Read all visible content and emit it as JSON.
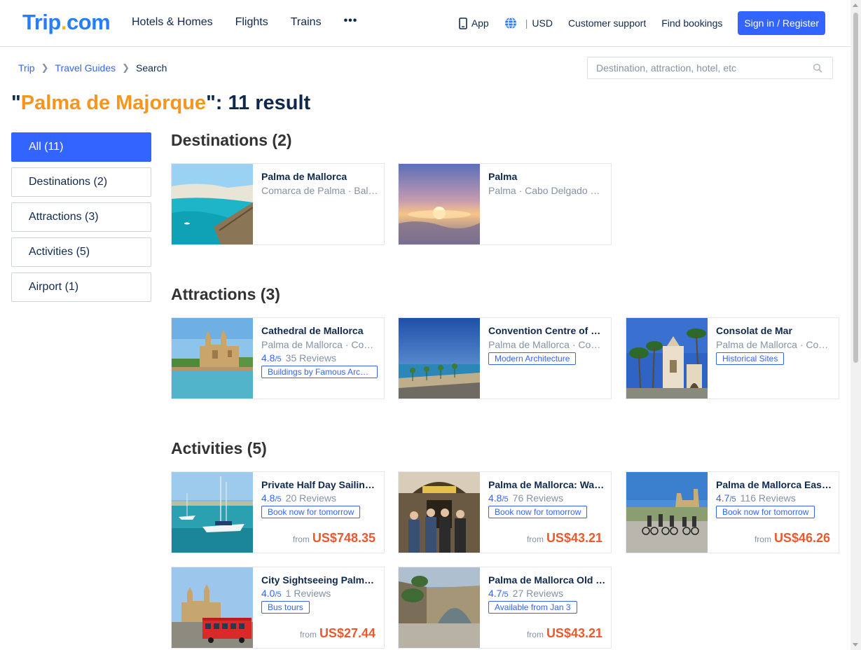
{
  "header": {
    "logo_main": "Trip",
    "logo_dot": ".",
    "logo_tld": "com",
    "nav": [
      "Hotels & Homes",
      "Flights",
      "Trains",
      "•••"
    ],
    "app_label": "App",
    "currency": "USD",
    "customer_support": "Customer support",
    "find_bookings": "Find bookings",
    "signin": "Sign in / Register"
  },
  "breadcrumb": {
    "items": [
      "Trip",
      "Travel Guides"
    ],
    "current": "Search"
  },
  "search": {
    "placeholder": "Destination, attraction, hotel, etc"
  },
  "title": {
    "open_quote": "\"",
    "query": "Palma de Majorque",
    "rest": "\": 11 result"
  },
  "filters": [
    {
      "label": "All (11)",
      "active": true
    },
    {
      "label": "Destinations (2)",
      "active": false
    },
    {
      "label": "Attractions (3)",
      "active": false
    },
    {
      "label": "Activities (5)",
      "active": false
    },
    {
      "label": "Airport (1)",
      "active": false
    }
  ],
  "sections": {
    "destinations": {
      "title": "Destinations (2)",
      "cards": [
        {
          "name": "Palma de Mallorca",
          "location": "Comarca de Palma · Balearic Islands"
        },
        {
          "name": "Palma",
          "location": "Palma · Cabo Delgado Province"
        }
      ]
    },
    "attractions": {
      "title": "Attractions (3)",
      "cards": [
        {
          "name": "Cathedral de Mallorca",
          "location": "Palma de Mallorca · Comarca de Palma",
          "score": "4.8",
          "outof": "/5",
          "reviews": "35 Reviews",
          "tag": "Buildings by Famous Architects"
        },
        {
          "name": "Convention Centre of Palma",
          "location": "Palma de Mallorca · Comarca de Palma",
          "tag": "Modern Architecture"
        },
        {
          "name": "Consolat de Mar",
          "location": "Palma de Mallorca · Comarca de Palma",
          "tag": "Historical Sites"
        }
      ]
    },
    "activities": {
      "title": "Activities (5)",
      "cards": [
        {
          "name": "Private Half Day Sailing Tour",
          "score": "4.8",
          "outof": "/5",
          "reviews": "20 Reviews",
          "tag": "Book now for tomorrow",
          "from": "from",
          "price": "US$748.35"
        },
        {
          "name": "Palma de Mallorca: Walking Tour",
          "score": "4.8",
          "outof": "/5",
          "reviews": "76 Reviews",
          "tag": "Book now for tomorrow",
          "from": "from",
          "price": "US$43.21"
        },
        {
          "name": "Palma de Mallorca Easy Bike Tour",
          "score": "4.7",
          "outof": "/5",
          "reviews": "116 Reviews",
          "tag": "Book now for tomorrow",
          "from": "from",
          "price": "US$46.26"
        },
        {
          "name": "City Sightseeing Palma Hop-On Hop-Off",
          "score": "4.0",
          "outof": "/5",
          "reviews": "1 Reviews",
          "tag": "Bus tours",
          "from": "from",
          "price": "US$27.44"
        },
        {
          "name": "Palma de Mallorca Old Town Tour",
          "score": "4.7",
          "outof": "/5",
          "reviews": "27 Reviews",
          "tag": "Available from Jan 3",
          "from": "from",
          "price": "US$43.21"
        }
      ]
    }
  }
}
